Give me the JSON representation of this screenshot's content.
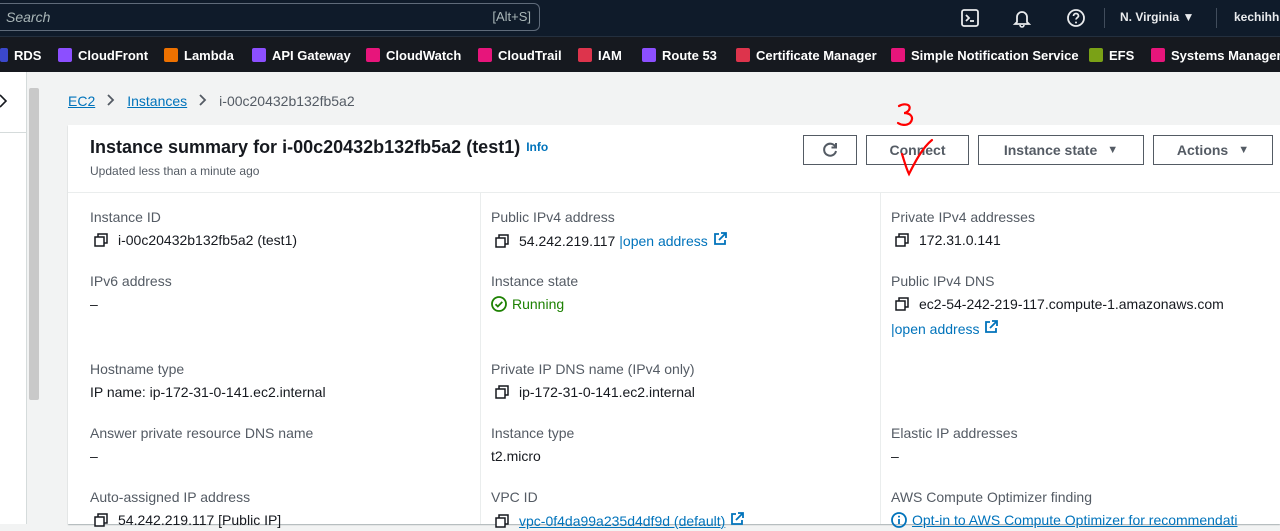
{
  "topnav": {
    "search_placeholder": "Search",
    "search_shortcut": "[Alt+S]",
    "region": "N. Virginia ▼",
    "user": "kechihh"
  },
  "services": [
    {
      "label": "RDS",
      "color": "#3b48cc"
    },
    {
      "label": "CloudFront",
      "color": "#8c4fff"
    },
    {
      "label": "Lambda",
      "color": "#ed7100"
    },
    {
      "label": "API Gateway",
      "color": "#8c4fff"
    },
    {
      "label": "CloudWatch",
      "color": "#e7157b"
    },
    {
      "label": "CloudTrail",
      "color": "#e7157b"
    },
    {
      "label": "IAM",
      "color": "#dd344c"
    },
    {
      "label": "Route 53",
      "color": "#8c4fff"
    },
    {
      "label": "Certificate Manager",
      "color": "#dd344c"
    },
    {
      "label": "Simple Notification Service",
      "color": "#e7157b"
    },
    {
      "label": "EFS",
      "color": "#7aa116"
    },
    {
      "label": "Systems Manager",
      "color": "#e7157b"
    }
  ],
  "breadcrumb": {
    "ec2": "EC2",
    "instances": "Instances",
    "current": "i-00c20432b132fb5a2"
  },
  "summary": {
    "title": "Instance summary for i-00c20432b132fb5a2 (test1)",
    "info": "Info",
    "updated": "Updated less than a minute ago",
    "connect_label": "Connect",
    "instance_state_label": "Instance state",
    "actions_label": "Actions"
  },
  "details": {
    "instance_id_label": "Instance ID",
    "instance_id": "i-00c20432b132fb5a2 (test1)",
    "ipv6_label": "IPv6 address",
    "ipv6": "–",
    "hostname_type_label": "Hostname type",
    "hostname_type": "IP name: ip-172-31-0-141.ec2.internal",
    "answer_dns_label": "Answer private resource DNS name",
    "answer_dns": "–",
    "auto_ip_label": "Auto-assigned IP address",
    "auto_ip": "54.242.219.117 [Public IP]",
    "public_ipv4_label": "Public IPv4 address",
    "public_ipv4": "54.242.219.117",
    "open_address": "|open address",
    "instance_state_label": "Instance state",
    "instance_state": "Running",
    "private_dns_label": "Private IP DNS name (IPv4 only)",
    "private_dns": "ip-172-31-0-141.ec2.internal",
    "instance_type_label": "Instance type",
    "instance_type": "t2.micro",
    "vpc_label": "VPC ID",
    "vpc": "vpc-0f4da99a235d4df9d (default)",
    "private_ipv4_label": "Private IPv4 addresses",
    "private_ipv4": "172.31.0.141",
    "public_dns_label": "Public IPv4 DNS",
    "public_dns": "ec2-54-242-219-117.compute-1.amazonaws.com",
    "open_address_2": "|open address",
    "elastic_ip_label": "Elastic IP addresses",
    "elastic_ip": "–",
    "optimizer_label": "AWS Compute Optimizer finding",
    "optimizer": "Opt-in to AWS Compute Optimizer for recommendati"
  },
  "colors": {
    "nav_bg": "#0f1b2a",
    "link": "#0073bb",
    "running": "#1d8102",
    "annotation": "#ff0000"
  }
}
